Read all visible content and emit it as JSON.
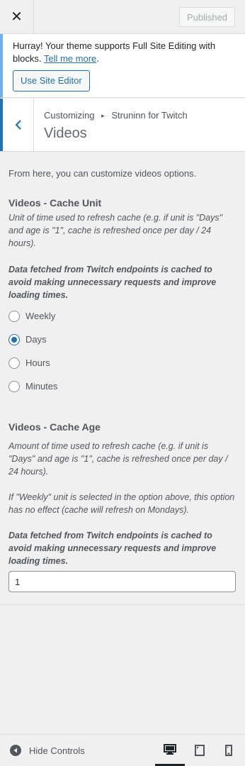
{
  "header": {
    "close_glyph": "✕",
    "publish_label": "Published"
  },
  "notice": {
    "text": "Hurray! Your theme supports Full Site Editing with blocks.",
    "link_text": "Tell me more",
    "after_link": ".",
    "button_label": "Use Site Editor"
  },
  "section": {
    "breadcrumb_root": "Customizing",
    "breadcrumb_sep": "▸",
    "breadcrumb_parent": "Struninn for Twitch",
    "title": "Videos"
  },
  "content": {
    "intro": "From here, you can customize videos options.",
    "cache_unit": {
      "title": "Videos - Cache Unit",
      "description": "Unit of time used to refresh cache (e.g. if unit is \"Days\" and age is \"1\", cache is refreshed once per day / 24 hours).",
      "note": "Data fetched from Twitch endpoints is cached to avoid making unnecessary requests and improve loading times.",
      "options": [
        "Weekly",
        "Days",
        "Hours",
        "Minutes"
      ],
      "selected": "Days"
    },
    "cache_age": {
      "title": "Videos - Cache Age",
      "description": "Amount of time used to refresh cache (e.g. if unit is \"Days\" and age is \"1\", cache is refreshed once per day / 24 hours).",
      "description2": "If \"Weekly\" unit is selected in the option above, this option has no effect (cache will refresh on Mondays).",
      "note": "Data fetched from Twitch endpoints is cached to avoid making unnecessary requests and improve loading times.",
      "value": "1"
    }
  },
  "footer": {
    "hide_label": "Hide Controls",
    "devices": [
      "desktop-icon",
      "tablet-icon",
      "mobile-icon"
    ],
    "active_device": "desktop"
  },
  "colors": {
    "accent": "#2271b1",
    "notice_border": "#72aee6",
    "background": "#f0f0f1"
  }
}
